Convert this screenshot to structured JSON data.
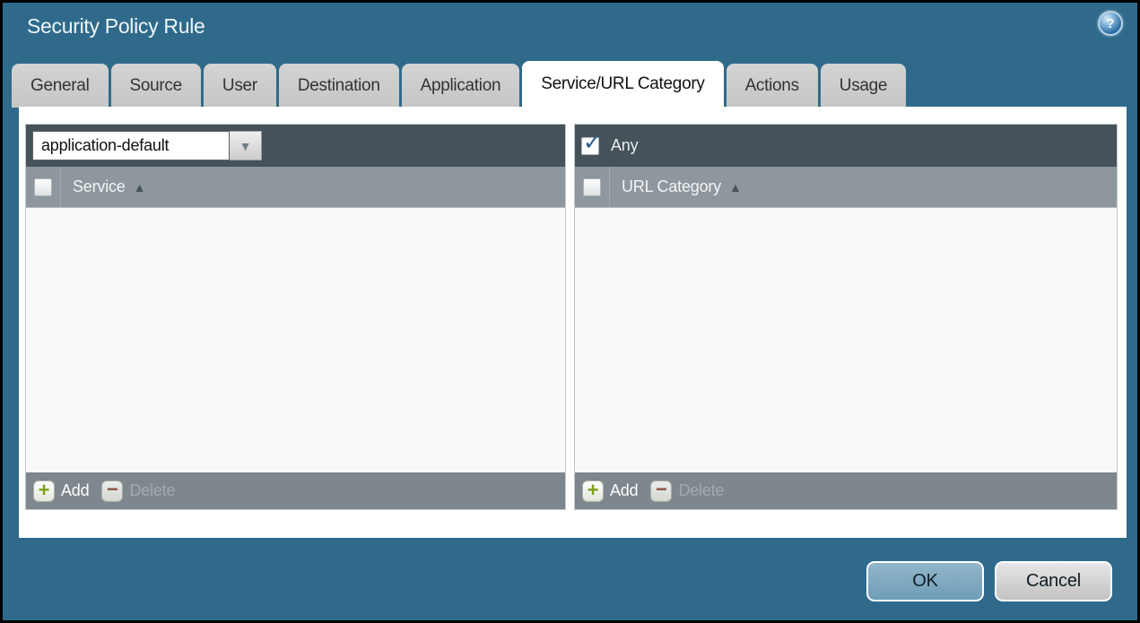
{
  "dialog": {
    "title": "Security Policy Rule"
  },
  "tabs": [
    {
      "label": "General"
    },
    {
      "label": "Source"
    },
    {
      "label": "User"
    },
    {
      "label": "Destination"
    },
    {
      "label": "Application"
    },
    {
      "label": "Service/URL Category"
    },
    {
      "label": "Actions"
    },
    {
      "label": "Usage"
    }
  ],
  "active_tab": "Service/URL Category",
  "service_panel": {
    "dropdown_value": "application-default",
    "column_header": "Service",
    "add_label": "Add",
    "delete_label": "Delete",
    "rows": []
  },
  "url_category_panel": {
    "any_label": "Any",
    "any_checked": true,
    "column_header": "URL Category",
    "add_label": "Add",
    "delete_label": "Delete",
    "rows": []
  },
  "buttons": {
    "ok_label": "OK",
    "cancel_label": "Cancel"
  },
  "icons": {
    "help": "?",
    "dropdown_arrow": "▼",
    "sort_ascending": "▲",
    "add_plus": "+",
    "delete_minus": "−",
    "checkmark": "✓"
  },
  "colors": {
    "background_teal": "#306a8b",
    "toolbar_dark": "#45525a",
    "header_gray": "#8e979d",
    "footer_gray": "#7e878d",
    "ok_button_blue": "#7fa9c1",
    "add_green": "#7fa01c",
    "delete_red": "#8c4a38",
    "check_blue": "#2b5d88"
  }
}
